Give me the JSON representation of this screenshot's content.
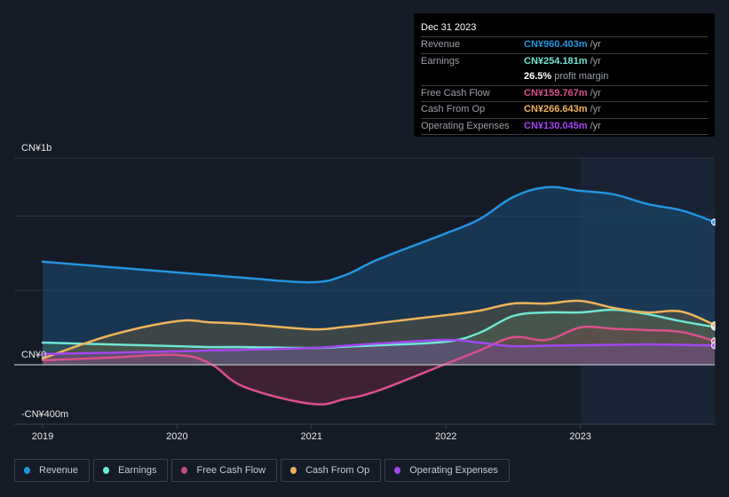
{
  "tooltip": {
    "date": "Dec 31 2023",
    "rows": [
      {
        "label": "Revenue",
        "value": "CN¥960.403m",
        "unit": "/yr",
        "color": "#2394df"
      },
      {
        "label": "Earnings",
        "value": "CN¥254.181m",
        "unit": "/yr",
        "color": "#6ee7d4"
      },
      {
        "label": "",
        "margin_value": "26.5%",
        "margin_text": "profit margin"
      },
      {
        "label": "Free Cash Flow",
        "value": "CN¥159.767m",
        "unit": "/yr",
        "color": "#d9508a"
      },
      {
        "label": "Cash From Op",
        "value": "CN¥266.643m",
        "unit": "/yr",
        "color": "#f0b35a"
      },
      {
        "label": "Operating Expenses",
        "value": "CN¥130.045m",
        "unit": "/yr",
        "color": "#a346ef"
      }
    ]
  },
  "legend": [
    {
      "label": "Revenue",
      "color": "#2394df"
    },
    {
      "label": "Earnings",
      "color": "#6ee7d4"
    },
    {
      "label": "Free Cash Flow",
      "color": "#c24a85"
    },
    {
      "label": "Cash From Op",
      "color": "#e8ad5e"
    },
    {
      "label": "Operating Expenses",
      "color": "#a346ef"
    }
  ],
  "chart_data": {
    "type": "area",
    "title": "",
    "xlabel": "",
    "ylabel": "",
    "currency": "CN¥",
    "x_ticks": [
      "2019",
      "2020",
      "2021",
      "2022",
      "2023"
    ],
    "y_tick_labels": [
      "CN¥1b",
      "CN¥0",
      "-CN¥400m"
    ],
    "y_tick_values": [
      1000,
      0,
      -400
    ],
    "ylim": [
      -400,
      1400
    ],
    "xlim": [
      2019.0,
      2024.0
    ],
    "grid": true,
    "highlight_from": 2023.0,
    "legend_position": "bottom-left",
    "x": [
      2019.0,
      2019.5,
      2020.0,
      2020.25,
      2020.5,
      2021.0,
      2021.25,
      2021.5,
      2022.0,
      2022.25,
      2022.5,
      2022.75,
      2023.0,
      2023.25,
      2023.5,
      2023.75,
      2024.0
    ],
    "series": [
      {
        "name": "Revenue",
        "color": "#2394df",
        "values": [
          693,
          657,
          621,
          603,
          585,
          555,
          603,
          710,
          884,
          979,
          1128,
          1194,
          1170,
          1146,
          1081,
          1039,
          960
        ]
      },
      {
        "name": "Earnings",
        "color": "#6ee7d4",
        "values": [
          149,
          137,
          125,
          119,
          119,
          113,
          122,
          131,
          155,
          215,
          328,
          352,
          352,
          370,
          340,
          293,
          254
        ]
      },
      {
        "name": "Free Cash Flow",
        "color": "#d9508a",
        "values": [
          30,
          48,
          66,
          6,
          -149,
          -263,
          -230,
          -173,
          6,
          96,
          185,
          167,
          251,
          242,
          233,
          221,
          160
        ]
      },
      {
        "name": "Cash From Op",
        "color": "#f0b35a",
        "values": [
          42,
          197,
          293,
          285,
          275,
          239,
          255,
          281,
          334,
          364,
          412,
          412,
          430,
          382,
          352,
          358,
          267
        ]
      },
      {
        "name": "Operating Expenses",
        "color": "#a346ef",
        "values": [
          72,
          81,
          90,
          96,
          101,
          113,
          128,
          143,
          167,
          149,
          125,
          128,
          131,
          134,
          137,
          134,
          130
        ]
      }
    ]
  }
}
